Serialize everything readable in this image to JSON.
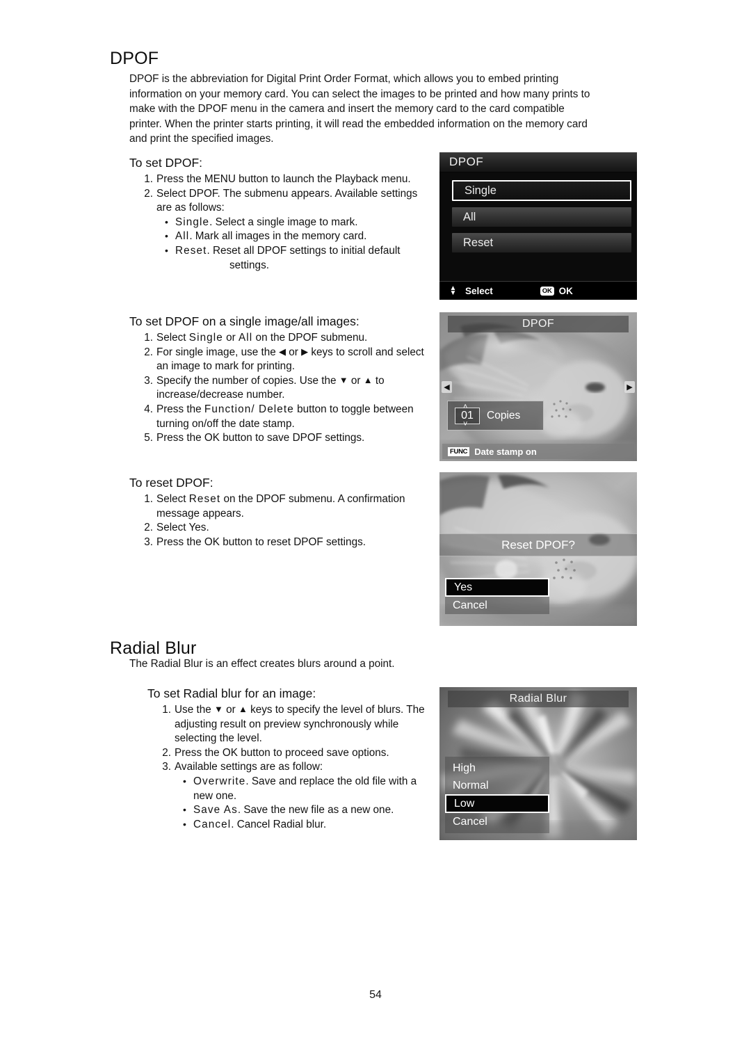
{
  "page": {
    "number": "54"
  },
  "sections": {
    "dpof": {
      "title": "DPOF",
      "intro": "DPOF is the abbreviation for Digital Print Order Format, which allows you to embed printing information on your memory card. You can select the images to be printed and how many prints to make with the DPOF menu in the camera and insert the memory card to the card compatible printer. When the printer starts printing, it will read the embedded information on the memory card and print the specified images.",
      "to_set": {
        "heading": "To set DPOF:",
        "step1_num": "1.",
        "step1": "Press the MENU button to launch the Playback menu.",
        "step2_num": "2.",
        "step2": "Select DPOF. The submenu appears. Available settings are as follows:",
        "bullet1_term": "Single",
        "bullet1_text": ". Select a single image to mark.",
        "bullet2_term": "All",
        "bullet2_text": ". Mark all images in the memory card.",
        "bullet3_term": "Reset",
        "bullet3_text": ". Reset all DPOF settings to initial default",
        "bullet3_cont": "settings."
      },
      "single_all": {
        "heading": "To set DPOF on a single image/all images:",
        "step1_num": "1.",
        "step1_a": "Select ",
        "step1_single": "Single",
        "step1_b": " or ",
        "step1_all": "All",
        "step1_c": " on the DPOF submenu.",
        "step2_num": "2.",
        "step2_a": "For single image, use the ",
        "step2_left_icon": "◀",
        "step2_b": " or ",
        "step2_right_icon": "▶",
        "step2_c": " keys to scroll and select an image to mark for printing.",
        "step3_num": "3.",
        "step3_a": "Specify the number of copies. Use the ",
        "step3_down_icon": "▼",
        "step3_b": " or ",
        "step3_up_icon": "▲",
        "step3_c": " to increase/decrease number.",
        "step4_num": "4.",
        "step4_a": "Press the ",
        "step4_func": "Function/ Delete",
        "step4_b": " button to toggle between turning on/off the date stamp.",
        "step5_num": "5.",
        "step5": "Press the OK button to save DPOF settings."
      },
      "reset": {
        "heading": "To reset DPOF:",
        "step1_num": "1.",
        "step1_a": "Select ",
        "step1_reset": "Reset",
        "step1_b": " on the DPOF submenu. A confirmation message appears.",
        "step2_num": "2.",
        "step2": "Select Yes.",
        "step3_num": "3.",
        "step3": "Press the OK button to reset DPOF settings."
      }
    },
    "radial_blur": {
      "title": "Radial Blur",
      "intro": "The Radial Blur is an effect creates blurs around a point.",
      "to_set": {
        "heading": "To set Radial blur for an image:",
        "step1_num": "1.",
        "step1_a": "Use the ",
        "step1_down_icon": "▼",
        "step1_b": " or ",
        "step1_up_icon": "▲",
        "step1_c": " keys to specify the level of blurs. The adjusting result on preview synchronously while selecting the level.",
        "step2_num": "2.",
        "step2": "Press the OK button to proceed save options.",
        "step3_num": "3.",
        "step3": "Available settings are as follow:",
        "bullet1_term": "Overwrite",
        "bullet1_text": ". Save and replace the old file with a new one.",
        "bullet2_term": "Save As",
        "bullet2_text": ". Save the new file as a new one.",
        "bullet3_term": "Cancel",
        "bullet3_text": ". Cancel Radial blur."
      }
    }
  },
  "screenshots": {
    "dpof_menu": {
      "title": "DPOF",
      "items": [
        {
          "label": "Single",
          "selected": true
        },
        {
          "label": "All",
          "selected": false
        },
        {
          "label": "Reset",
          "selected": false
        }
      ],
      "status_select_icon": "up-down-arrows-icon",
      "status_select_label": "Select",
      "status_ok_badge": "OK",
      "status_ok_label": "OK"
    },
    "copies": {
      "title": "DPOF",
      "nav_left_icon": "◀",
      "nav_right_icon": "▶",
      "chevron_up": "˄",
      "chevron_down": "˅",
      "count": "01",
      "count_label": "Copies",
      "func_badge": "FUNC",
      "func_label": "Date stamp on"
    },
    "reset_confirm": {
      "message": "Reset DPOF?",
      "choices": [
        {
          "label": "Yes",
          "selected": true
        },
        {
          "label": "Cancel",
          "selected": false
        }
      ]
    },
    "radial_blur": {
      "title": "Radial Blur",
      "levels": [
        {
          "label": "High",
          "selected": false
        },
        {
          "label": "Normal",
          "selected": false
        },
        {
          "label": "Low",
          "selected": true
        },
        {
          "label": "Cancel",
          "selected": false
        }
      ]
    }
  }
}
